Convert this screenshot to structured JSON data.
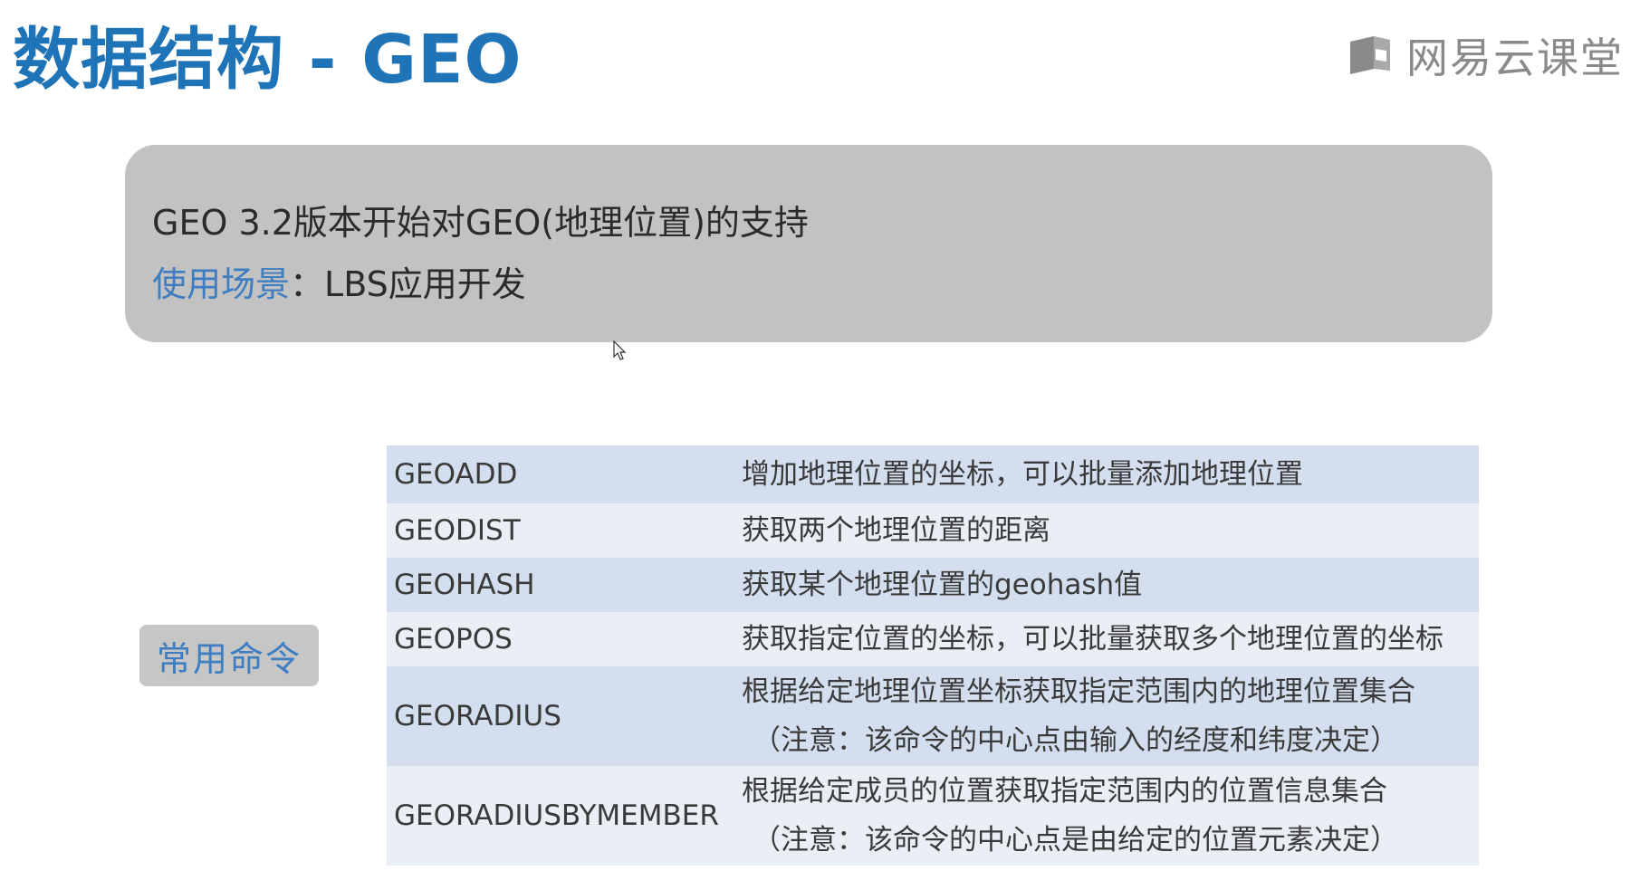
{
  "slide": {
    "title": "数据结构 - GEO"
  },
  "logo": {
    "text": "网易云课堂",
    "icon": "book-logo-icon"
  },
  "intro": {
    "line1": "GEO 3.2版本开始对GEO(地理位置)的支持",
    "usage_label": "使用场景",
    "usage_sep": "：",
    "usage_value": "LBS应用开发"
  },
  "commands_badge": "常用命令",
  "commands": [
    {
      "name": "GEOADD",
      "desc": "增加地理位置的坐标，可以批量添加地理位置",
      "note": ""
    },
    {
      "name": "GEODIST",
      "desc": "获取两个地理位置的距离",
      "note": ""
    },
    {
      "name": "GEOHASH",
      "desc": "获取某个地理位置的geohash值",
      "note": ""
    },
    {
      "name": "GEOPOS",
      "desc": "获取指定位置的坐标，可以批量获取多个地理位置的坐标",
      "note": ""
    },
    {
      "name": "GEORADIUS",
      "desc": "根据给定地理位置坐标获取指定范围内的地理位置集合",
      "note": "（注意：该命令的中心点由输入的经度和纬度决定）"
    },
    {
      "name": "GEORADIUSBYMEMBER",
      "desc": "根据给定成员的位置获取指定范围内的位置信息集合",
      "note": "（注意：该命令的中心点是由给定的位置元素决定）"
    }
  ],
  "colors": {
    "title": "#1f73b7",
    "accent": "#3d7dc0",
    "box": "#c2c2c2",
    "row_dark": "#d3dfee",
    "row_light": "#eaeff6"
  }
}
